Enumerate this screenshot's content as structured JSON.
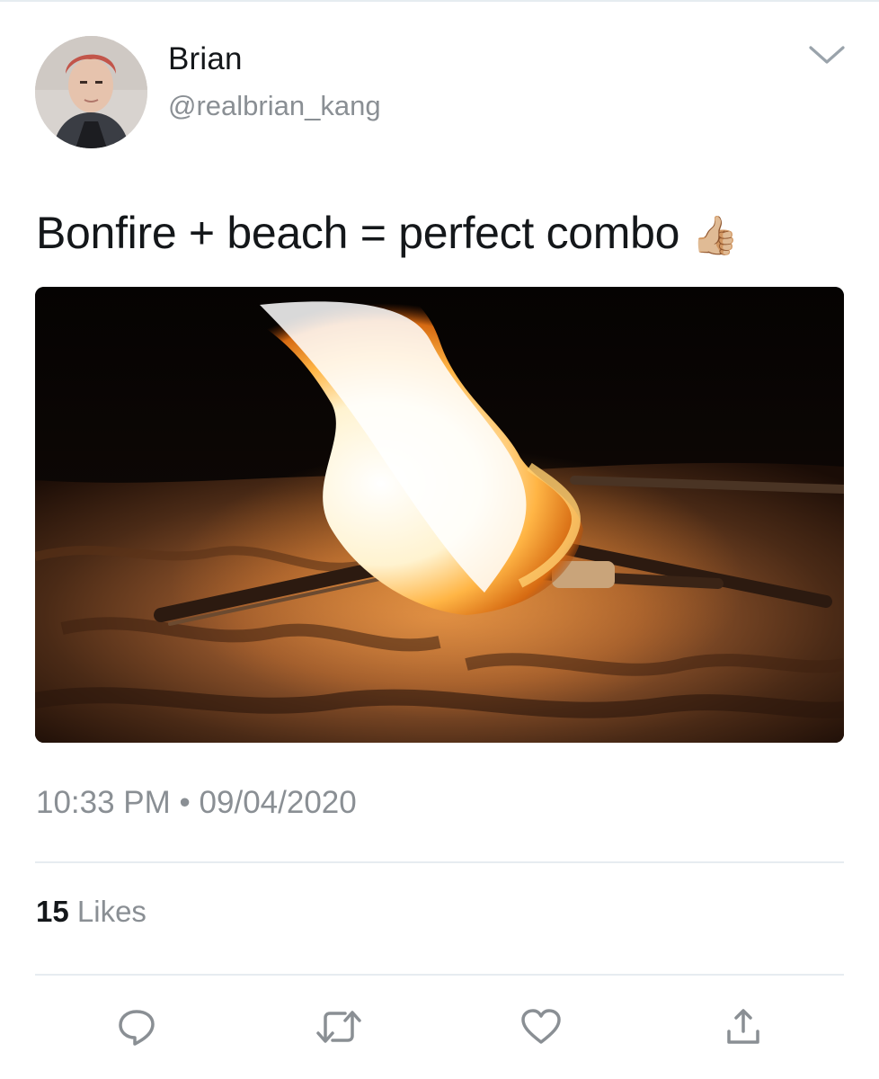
{
  "tweet": {
    "author": {
      "name": "Brian",
      "handle": "@realbrian_kang"
    },
    "text": "Bonfire + beach = perfect combo",
    "emoji": "👍🏼",
    "media": {
      "description_icon": "photo"
    },
    "time": "10:33 PM",
    "separator": "•",
    "date": "09/04/2020",
    "likes": {
      "count": "15",
      "label": "Likes"
    }
  },
  "icons": {
    "menu": "chevron-down-icon",
    "reply": "reply-icon",
    "retweet": "retweet-icon",
    "like": "heart-icon",
    "share": "share-icon"
  },
  "colors": {
    "text": "#14171a",
    "secondary": "#8a8f94",
    "divider": "#e6ecf0",
    "icon": "#8a8f94"
  }
}
